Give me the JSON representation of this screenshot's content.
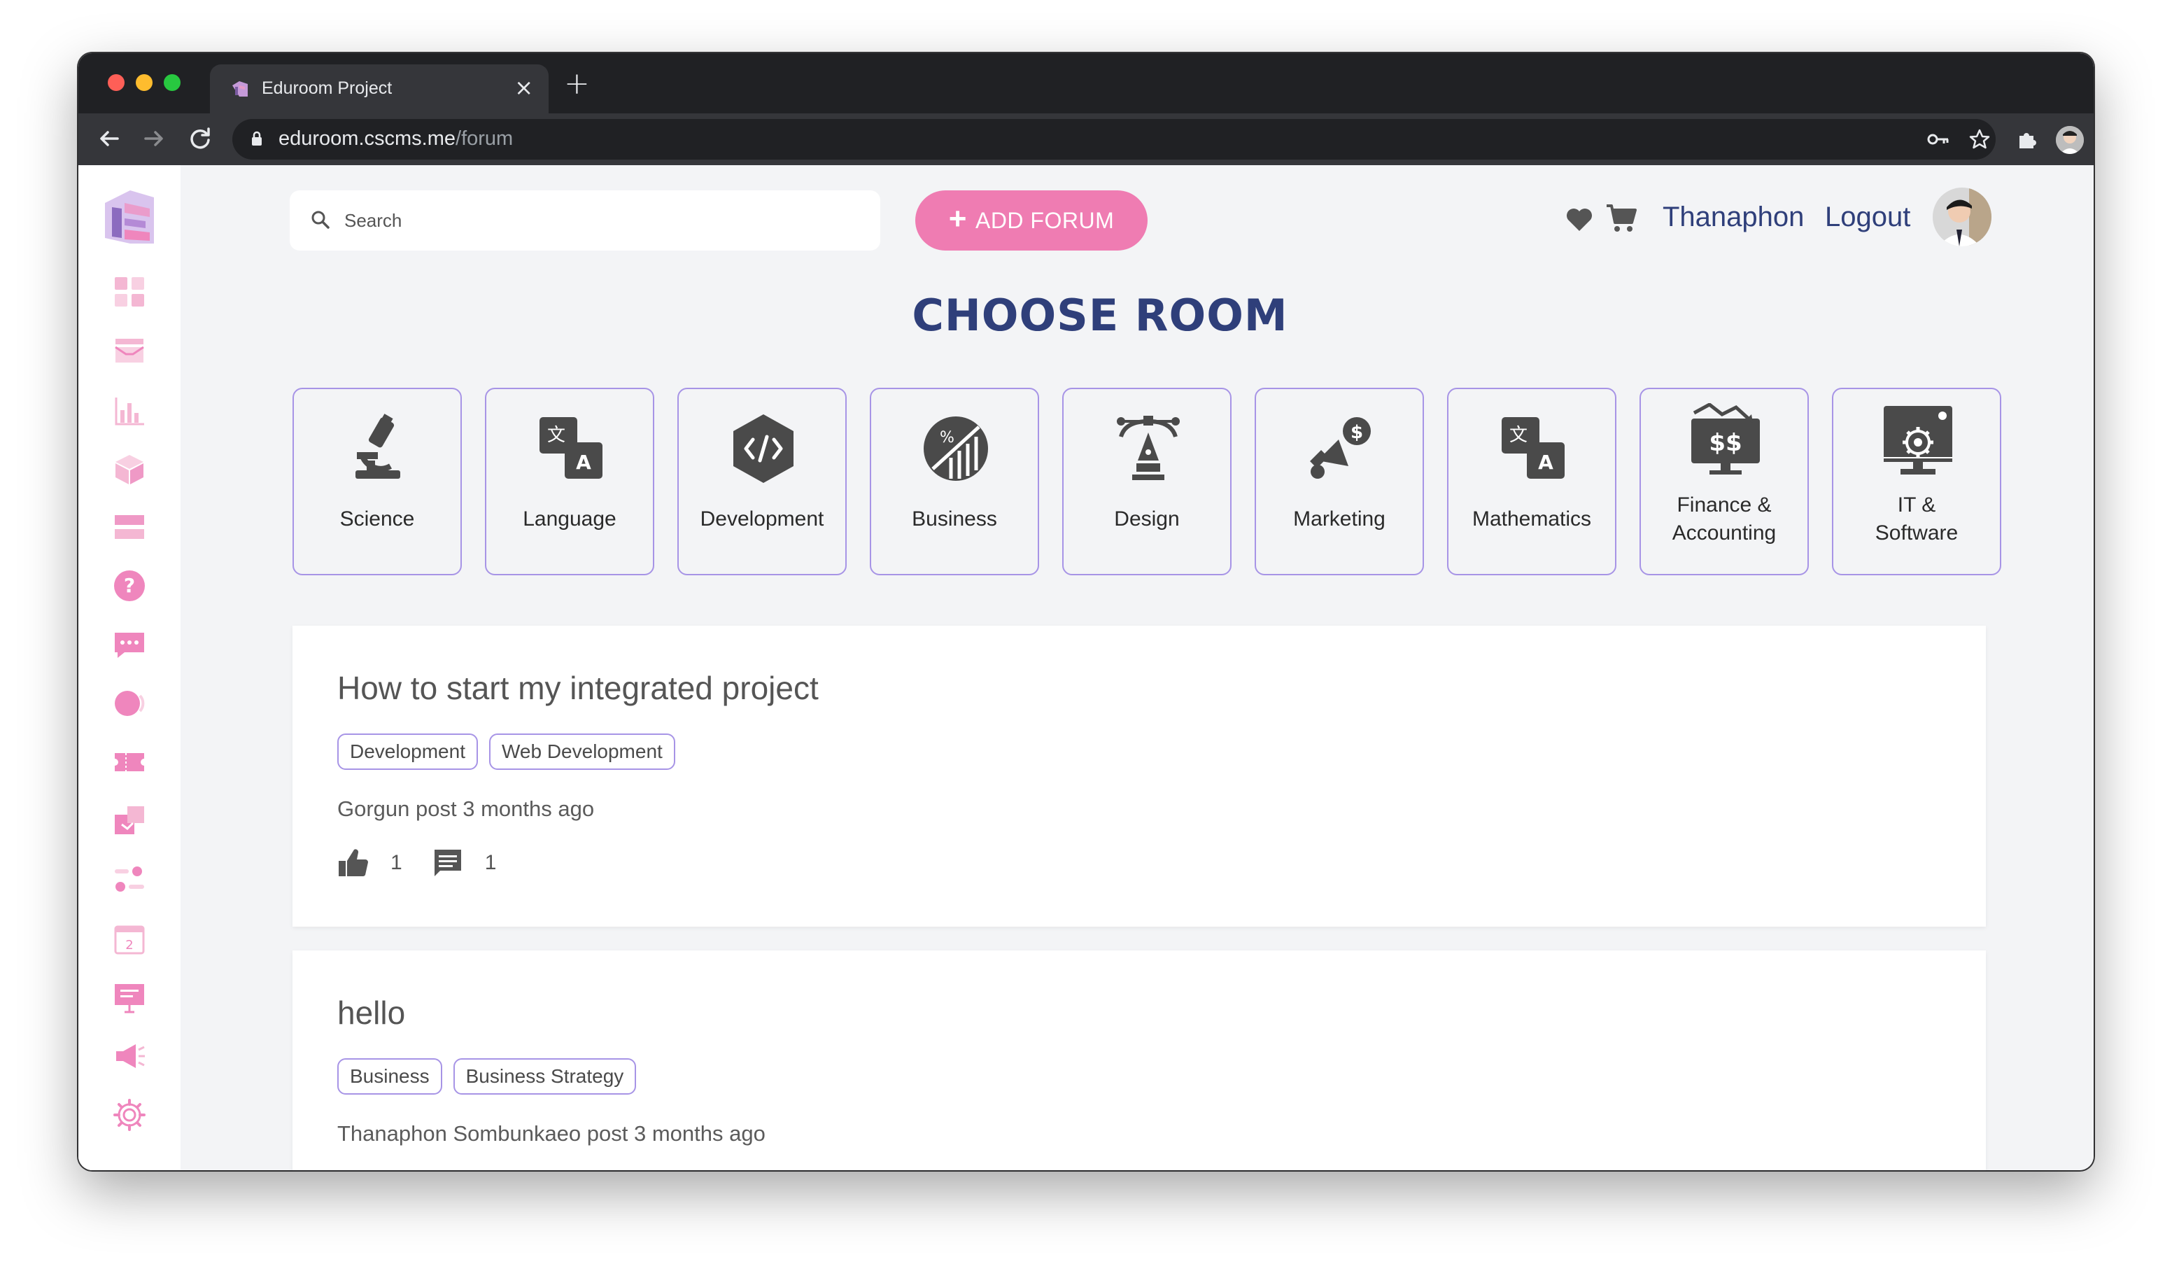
{
  "browser": {
    "tab_title": "Eduroom Project",
    "tab_close": "×",
    "new_tab": "+",
    "url_host": "eduroom.cscms.me",
    "url_path": "/forum"
  },
  "header": {
    "search_placeholder": "Search",
    "add_forum_label": "ADD FORUM",
    "user_name": "Thanaphon",
    "logout_label": "Logout"
  },
  "page_title": "CHOOSE ROOM",
  "rooms": [
    {
      "line1": "Science",
      "line2": "",
      "icon": "microscope-icon"
    },
    {
      "line1": "Language",
      "line2": "",
      "icon": "translate-icon"
    },
    {
      "line1": "Development",
      "line2": "",
      "icon": "code-icon"
    },
    {
      "line1": "Business",
      "line2": "",
      "icon": "business-chart-icon"
    },
    {
      "line1": "Design",
      "line2": "",
      "icon": "pen-tool-icon"
    },
    {
      "line1": "Marketing",
      "line2": "",
      "icon": "megaphone-icon"
    },
    {
      "line1": "Mathematics",
      "line2": "",
      "icon": "translate-icon"
    },
    {
      "line1": "Finance &",
      "line2": "Accounting",
      "icon": "finance-monitor-icon"
    },
    {
      "line1": "IT &",
      "line2": "Software",
      "icon": "software-monitor-icon"
    }
  ],
  "posts": [
    {
      "title": "How to start my integrated project",
      "tags": [
        "Development",
        "Web Development"
      ],
      "meta": "Gorgun post 3 months ago",
      "likes": "1",
      "comments": "1"
    },
    {
      "title": "hello",
      "tags": [
        "Business",
        "Business Strategy"
      ],
      "meta": "Thanaphon Sombunkaeo post 3 months ago"
    }
  ],
  "colors": {
    "accent_pink": "#ef7cb2",
    "navy": "#2f3f7a",
    "room_border": "#a794e6",
    "icon_gray": "#4a4a4a"
  }
}
